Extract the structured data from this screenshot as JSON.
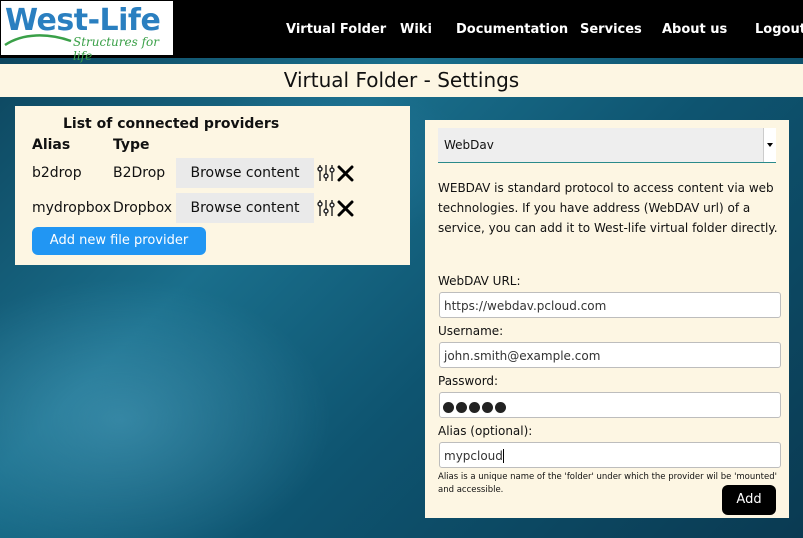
{
  "navbar": {
    "logo_text": "West-Life",
    "logo_tagline": "Structures for life",
    "items": [
      {
        "label": "Virtual Folder"
      },
      {
        "label": "Wiki"
      },
      {
        "label": "Documentation"
      },
      {
        "label": "Services"
      },
      {
        "label": "About us"
      },
      {
        "label": "Logout"
      }
    ]
  },
  "page": {
    "title": "Virtual Folder - Settings"
  },
  "providers": {
    "heading": "List of connected providers",
    "col_alias": "Alias",
    "col_type": "Type",
    "rows": [
      {
        "alias": "b2drop",
        "type": "B2Drop",
        "browse_label": "Browse content"
      },
      {
        "alias": "mydropbox",
        "type": "Dropbox",
        "browse_label": "Browse content"
      }
    ],
    "add_label": "Add new file provider"
  },
  "form": {
    "provider_type": "WebDav",
    "description": "WEBDAV is standard protocol to access content via web technologies. If you have address (WebDAV url) of a service, you can add it to West-life virtual folder directly.",
    "url_label": "WebDAV URL:",
    "url_value": "https://webdav.pcloud.com",
    "username_label": "Username:",
    "username_value": "john.smith@example.com",
    "password_label": "Password:",
    "password_length": 5,
    "alias_label": "Alias (optional):",
    "alias_value": "mypcloud",
    "hint": "Alias is a unique name of the 'folder' under which the provider wil be 'mounted' and accessible.",
    "add_label": "Add"
  },
  "colors": {
    "navbar_bg": "#000000",
    "panel_bg": "#fdf6e3",
    "primary_button": "#2196f3",
    "add_button": "#000000"
  },
  "icons": [
    "settings-sliders-icon",
    "close-icon",
    "chevron-down-icon"
  ]
}
